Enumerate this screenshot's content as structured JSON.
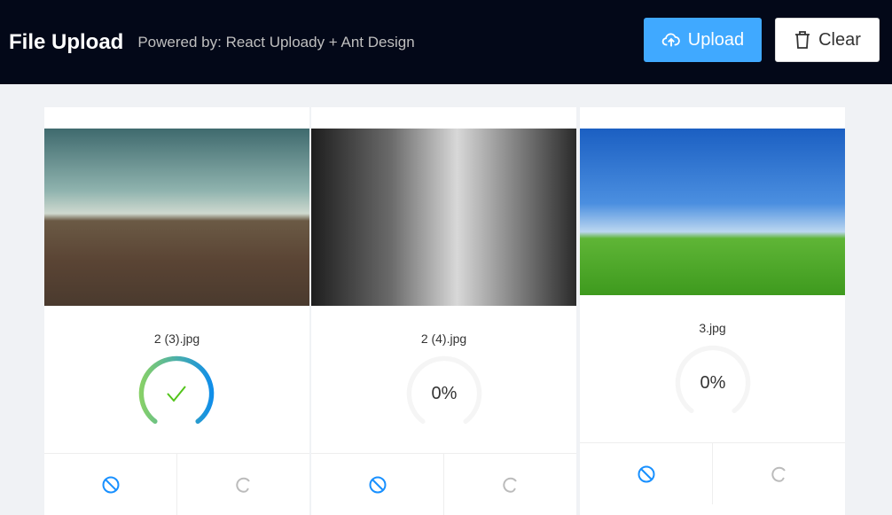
{
  "header": {
    "title": "File Upload",
    "subtitle": "Powered by: React Uploady + Ant Design",
    "upload_label": "Upload",
    "clear_label": "Clear"
  },
  "colors": {
    "header_bg": "#030818",
    "accent": "#40a9ff",
    "success": "#52c41a"
  },
  "files": [
    {
      "name": "2 (3).jpg",
      "progress": 100,
      "status": "done",
      "progress_text": ""
    },
    {
      "name": "2 (4).jpg",
      "progress": 0,
      "status": "pending",
      "progress_text": "0%"
    },
    {
      "name": "3.jpg",
      "progress": 0,
      "status": "pending",
      "progress_text": "0%"
    }
  ],
  "icons": {
    "cancel": "stop-icon",
    "retry": "redo-icon"
  }
}
